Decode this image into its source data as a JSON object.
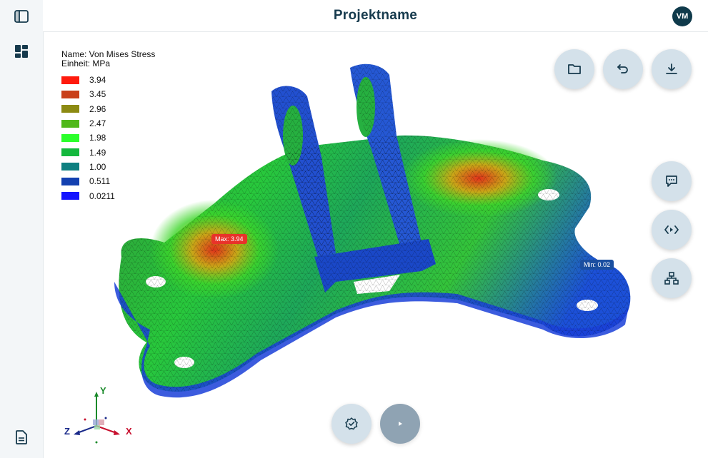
{
  "header": {
    "title": "Projektname",
    "avatar_initials": "VM"
  },
  "legend": {
    "name": "Name: Von Mises Stress",
    "unit": "Einheit: MPa",
    "items": [
      {
        "value": "3.94",
        "color": "#ff1a0d"
      },
      {
        "value": "3.45",
        "color": "#c9401a"
      },
      {
        "value": "2.96",
        "color": "#8c8a12"
      },
      {
        "value": "2.47",
        "color": "#4fb81a"
      },
      {
        "value": "1.98",
        "color": "#2bff2b"
      },
      {
        "value": "1.49",
        "color": "#14b83d"
      },
      {
        "value": "1.00",
        "color": "#0e7f80"
      },
      {
        "value": "0.511",
        "color": "#1340b0"
      },
      {
        "value": "0.0211",
        "color": "#1414ff"
      }
    ]
  },
  "markers": {
    "max": "Max: 3.94",
    "min": "Min: 0.02"
  },
  "axes": {
    "x": "X",
    "y": "Y",
    "z": "Z"
  },
  "colors": {
    "accent": "#163a4d",
    "button_bg": "#d4e1ea",
    "play_bg": "#8fa3b3"
  }
}
